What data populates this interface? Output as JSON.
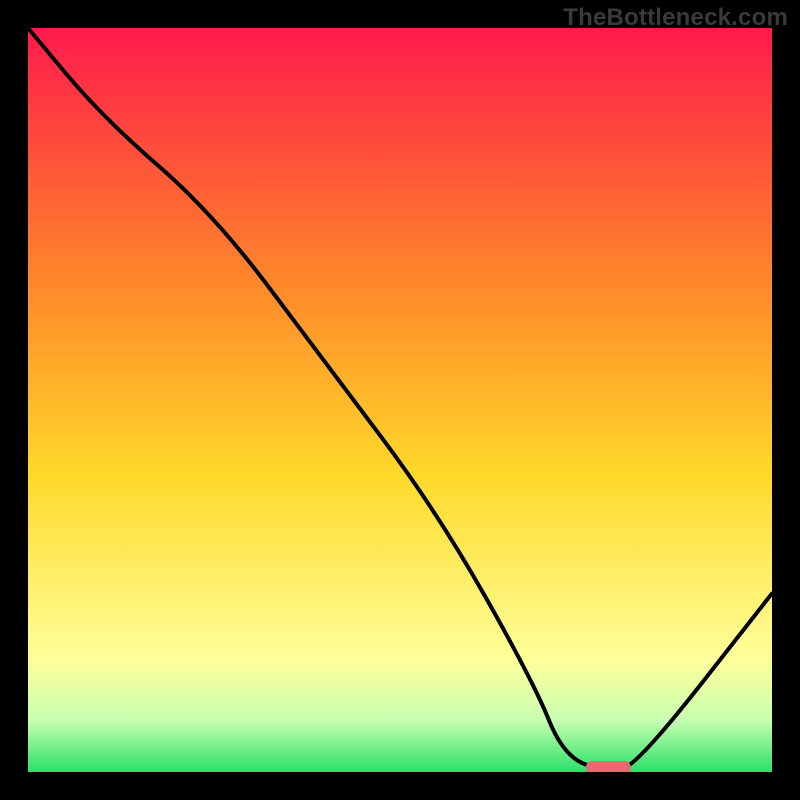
{
  "watermark": "TheBottleneck.com",
  "colors": {
    "bg": "#000000",
    "watermark": "#3a3a3a",
    "curve": "#000000",
    "marker_fill": "#e46a72",
    "grad_top": "#ff1a4a",
    "grad_mid1": "#ff8a2a",
    "grad_mid2": "#ffd92a",
    "grad_mid3": "#ffff9a",
    "grad_bottom": "#2be06a"
  },
  "chart_data": {
    "type": "line",
    "title": "",
    "xlabel": "",
    "ylabel": "",
    "xlim": [
      0,
      100
    ],
    "ylim": [
      0,
      100
    ],
    "annotations": [],
    "series": [
      {
        "name": "bottleneck-curve",
        "x": [
          0,
          10,
          25,
          40,
          55,
          68,
          72,
          78,
          82,
          100
        ],
        "y": [
          100,
          88,
          75,
          55,
          35,
          12,
          2,
          0,
          1,
          24
        ]
      }
    ],
    "marker": {
      "x": 78,
      "y": 0,
      "width": 6,
      "height": 2
    }
  }
}
